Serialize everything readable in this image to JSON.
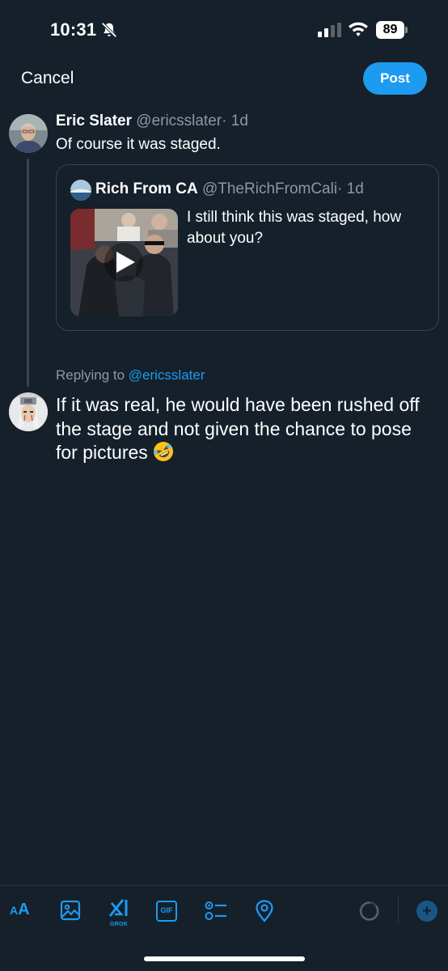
{
  "status_bar": {
    "time": "10:31",
    "battery": "89",
    "icons": [
      "bell-off-icon",
      "signal-icon",
      "wifi-icon",
      "battery-icon"
    ]
  },
  "header": {
    "cancel_label": "Cancel",
    "post_label": "Post"
  },
  "original_tweet": {
    "name": "Eric Slater",
    "handle": "@ericsslater",
    "time": "· 1d",
    "text": "Of course it was staged."
  },
  "quoted_tweet": {
    "name": "Rich From CA",
    "handle": "@TheRichFromCali",
    "time": "· 1d",
    "text": "I still think this was staged, how about you?",
    "media": "video-thumbnail-with-play-icon"
  },
  "reply": {
    "replying_prefix": "Replying to ",
    "replying_to": "@ericsslater",
    "text": "If it was real, he would have been rushed off the stage and not given the chance to pose for pictures"
  },
  "toolbar": {
    "text_size_small": "A",
    "text_size_big": "A",
    "grok_label": "GROK",
    "gif_label": "GIF",
    "icons": [
      "text-size-icon",
      "image-icon",
      "grok-icon",
      "gif-icon",
      "poll-icon",
      "location-icon",
      "character-count-ring",
      "add-post-icon"
    ]
  },
  "colors": {
    "background": "#15202b",
    "accent": "#1d9bf0",
    "muted": "#8b98a5",
    "border": "#38444d"
  }
}
